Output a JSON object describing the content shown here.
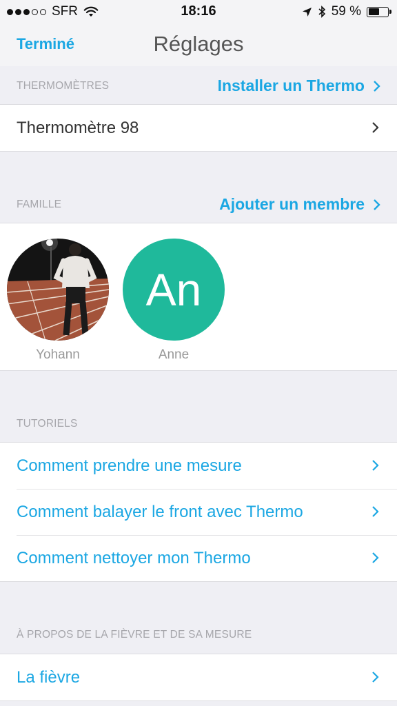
{
  "status_bar": {
    "carrier": "SFR",
    "time": "18:16",
    "battery": "59 %",
    "battery_level": 0.59,
    "signal_bars_filled": 3,
    "signal_bars_total": 5
  },
  "nav": {
    "done_label": "Terminé",
    "title": "Réglages"
  },
  "thermometers": {
    "header": "THERMOMÈTRES",
    "action": "Installer un Thermo",
    "items": [
      {
        "label": "Thermomètre 98"
      }
    ]
  },
  "family": {
    "header": "FAMILLE",
    "action": "Ajouter un membre",
    "members": [
      {
        "name": "Yohann",
        "avatar": "photo"
      },
      {
        "name": "Anne",
        "initials": "An",
        "avatar_color": "#1fb99b"
      }
    ]
  },
  "tutorials": {
    "header": "TUTORIELS",
    "items": [
      {
        "label": "Comment prendre une mesure"
      },
      {
        "label": "Comment balayer le front avec Thermo"
      },
      {
        "label": "Comment nettoyer mon Thermo"
      }
    ]
  },
  "about": {
    "header": "À PROPOS DE LA FIÈVRE ET DE SA MESURE",
    "items": [
      {
        "label": "La fièvre"
      }
    ]
  },
  "colors": {
    "accent": "#1ba7e3",
    "background": "#efeff4"
  },
  "icons": [
    "signal-icon",
    "wifi-icon",
    "location-arrow-icon",
    "bluetooth-icon",
    "battery-icon",
    "chevron-right-icon"
  ]
}
